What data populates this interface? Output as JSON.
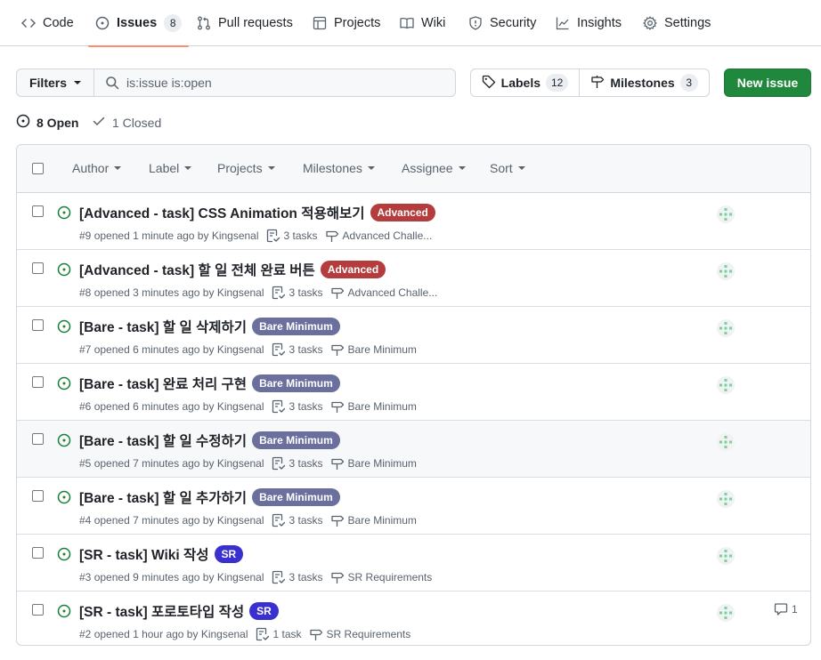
{
  "nav": {
    "tabs": [
      {
        "label": "Code",
        "icon": "code-icon"
      },
      {
        "label": "Issues",
        "icon": "issue-opened-icon",
        "count": "8",
        "active": true
      },
      {
        "label": "Pull requests",
        "icon": "git-pull-request-icon"
      },
      {
        "label": "Projects",
        "icon": "table-icon"
      },
      {
        "label": "Wiki",
        "icon": "book-icon"
      },
      {
        "label": "Security",
        "icon": "shield-icon"
      },
      {
        "label": "Insights",
        "icon": "graph-icon"
      },
      {
        "label": "Settings",
        "icon": "gear-icon"
      }
    ]
  },
  "subnav": {
    "filters_label": "Filters",
    "search_value": "is:issue is:open",
    "labels_label": "Labels",
    "labels_count": "12",
    "milestones_label": "Milestones",
    "milestones_count": "3",
    "new_issue_label": "New issue"
  },
  "states": {
    "open_label": "8 Open",
    "closed_label": "1 Closed"
  },
  "header_filters": [
    "Author",
    "Label",
    "Projects",
    "Milestones",
    "Assignee",
    "Sort"
  ],
  "colors": {
    "accent_green": "#1f883d",
    "open_icon": "#1a7f37",
    "label_advanced": "#b43c3c",
    "label_bare": "#6a6f9e",
    "label_sr": "#3a2fd0",
    "tab_underline": "#fd8c73"
  },
  "issues": [
    {
      "title": "[Advanced - task] CSS Animation 적용해보기",
      "label": "Advanced",
      "label_color": "#b43c3c",
      "number": "#9",
      "opened": "opened 1 minute ago by",
      "author": "Kingsenal",
      "tasks": "3 tasks",
      "milestone": "Advanced Challe...",
      "comments": ""
    },
    {
      "title": "[Advanced - task] 할 일 전체 완료 버튼",
      "label": "Advanced",
      "label_color": "#b43c3c",
      "number": "#8",
      "opened": "opened 3 minutes ago by",
      "author": "Kingsenal",
      "tasks": "3 tasks",
      "milestone": "Advanced Challe...",
      "comments": ""
    },
    {
      "title": "[Bare - task] 할 일 삭제하기",
      "label": "Bare Minimum",
      "label_color": "#6a6f9e",
      "number": "#7",
      "opened": "opened 6 minutes ago by",
      "author": "Kingsenal",
      "tasks": "3 tasks",
      "milestone": "Bare Minimum",
      "comments": ""
    },
    {
      "title": "[Bare - task] 완료 처리 구현",
      "label": "Bare Minimum",
      "label_color": "#6a6f9e",
      "number": "#6",
      "opened": "opened 6 minutes ago by",
      "author": "Kingsenal",
      "tasks": "3 tasks",
      "milestone": "Bare Minimum",
      "comments": ""
    },
    {
      "title": "[Bare - task] 할 일 수정하기",
      "label": "Bare Minimum",
      "label_color": "#6a6f9e",
      "number": "#5",
      "opened": "opened 7 minutes ago by",
      "author": "Kingsenal",
      "tasks": "3 tasks",
      "milestone": "Bare Minimum",
      "comments": ""
    },
    {
      "title": "[Bare - task] 할 일 추가하기",
      "label": "Bare Minimum",
      "label_color": "#6a6f9e",
      "number": "#4",
      "opened": "opened 7 minutes ago by",
      "author": "Kingsenal",
      "tasks": "3 tasks",
      "milestone": "Bare Minimum",
      "comments": ""
    },
    {
      "title": "[SR - task] Wiki 작성",
      "label": "SR",
      "label_color": "#3a2fd0",
      "number": "#3",
      "opened": "opened 9 minutes ago by",
      "author": "Kingsenal",
      "tasks": "3 tasks",
      "milestone": "SR Requirements",
      "comments": ""
    },
    {
      "title": "[SR - task] 포로토타입 작성",
      "label": "SR",
      "label_color": "#3a2fd0",
      "number": "#2",
      "opened": "opened 1 hour ago by",
      "author": "Kingsenal",
      "tasks": "1 task",
      "milestone": "SR Requirements",
      "comments": "1"
    }
  ]
}
